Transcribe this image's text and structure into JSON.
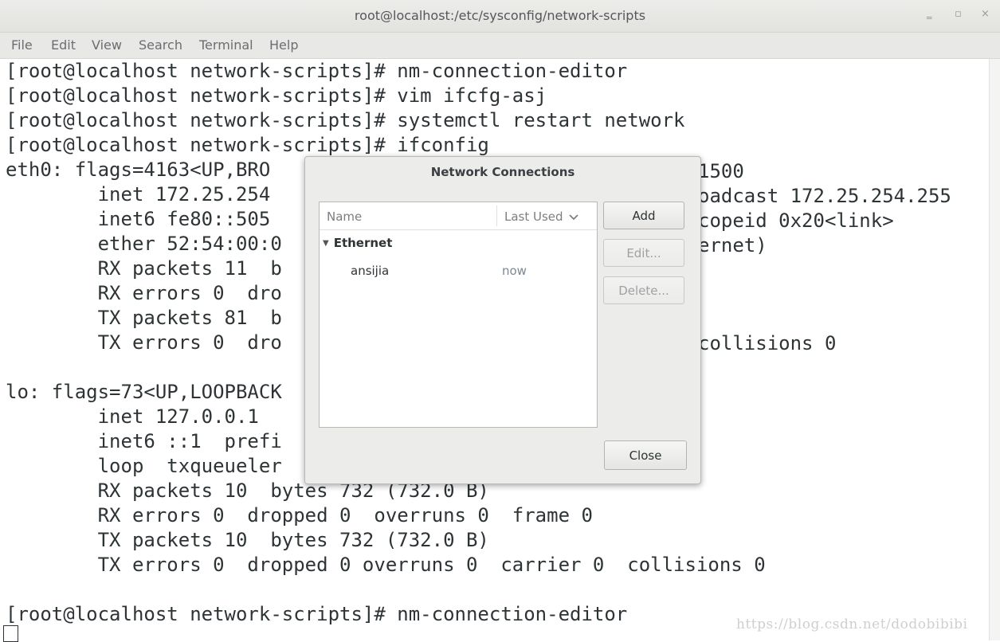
{
  "window": {
    "title": "root@localhost:/etc/sysconfig/network-scripts",
    "controls": {
      "minimize": "‗",
      "maximize": "▫",
      "close": "×"
    }
  },
  "menu": [
    "File",
    "Edit",
    "View",
    "Search",
    "Terminal",
    "Help"
  ],
  "terminal_lines": [
    "[root@localhost network-scripts]# nm-connection-editor",
    "[root@localhost network-scripts]# vim ifcfg-asj",
    "[root@localhost network-scripts]# systemctl restart network",
    "[root@localhost network-scripts]# ifconfig",
    "eth0: flags=4163<UP,BRO",
    "        inet 172.25.254",
    "        inet6 fe80::505",
    "        ether 52:54:00:0",
    "        RX packets 11  b",
    "        RX errors 0  dro",
    "        TX packets 81  b",
    "        TX errors 0  dro",
    "",
    "lo: flags=73<UP,LOOPBACK",
    "        inet 127.0.0.1",
    "        inet6 ::1  prefi",
    "        loop  txqueueler",
    "        RX packets 10  bytes 732 (732.0 B)",
    "        RX errors 0  dropped 0  overruns 0  frame 0",
    "        TX packets 10  bytes 732 (732.0 B)",
    "        TX errors 0  dropped 0 overruns 0  carrier 0  collisions 0",
    "",
    "[root@localhost network-scripts]# nm-connection-editor"
  ],
  "terminal_right_fragments": [
    "1500",
    "oadcast 172.25.254.255",
    "copeid 0x20<link>",
    "ernet)",
    "collisions 0"
  ],
  "watermark": "https://blog.csdn.net/dodobibibi",
  "dialog": {
    "title": "Network Connections",
    "columns": {
      "name": "Name",
      "last_used": "Last Used"
    },
    "group": "Ethernet",
    "connections": [
      {
        "name": "ansijia",
        "last_used": "now"
      }
    ],
    "buttons": {
      "add": "Add",
      "edit": "Edit...",
      "delete": "Delete...",
      "close": "Close"
    }
  }
}
